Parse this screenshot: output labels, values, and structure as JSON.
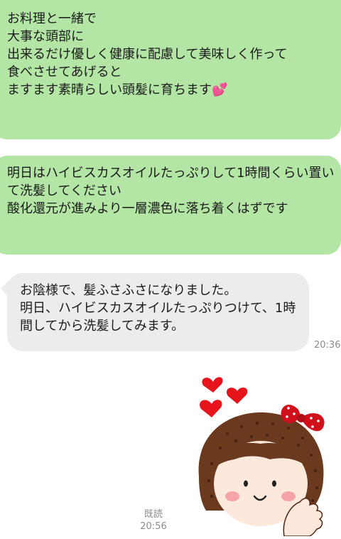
{
  "messages": [
    {
      "direction": "sent",
      "text": "お料理と一緒で\n大事な頭部に\n出来るだけ優しく健康に配慮して美味しく作って\n食べさせてあげると\nますます素晴らしい頭髪に育ちます💕"
    },
    {
      "direction": "sent",
      "text": "明日はハイビスカスオイルたっぷりして1時間くらい置いて洗髪してください\n酸化還元が進みより一層濃色に落ち着くはずです"
    },
    {
      "direction": "received",
      "text": "お陰様で、髪ふさふさになりました。\n明日、ハイビスカスオイルたっぷりつけて、1時間してから洗髪してみます。",
      "time": "20:36"
    }
  ],
  "sticker": {
    "icon": "girl-with-hearts-sticker-icon",
    "read_label": "既読",
    "time": "20:56"
  },
  "colors": {
    "sent_bubble": "#b3e5a5",
    "received_bubble": "#ececec",
    "timestamp": "#8a8a8a"
  }
}
